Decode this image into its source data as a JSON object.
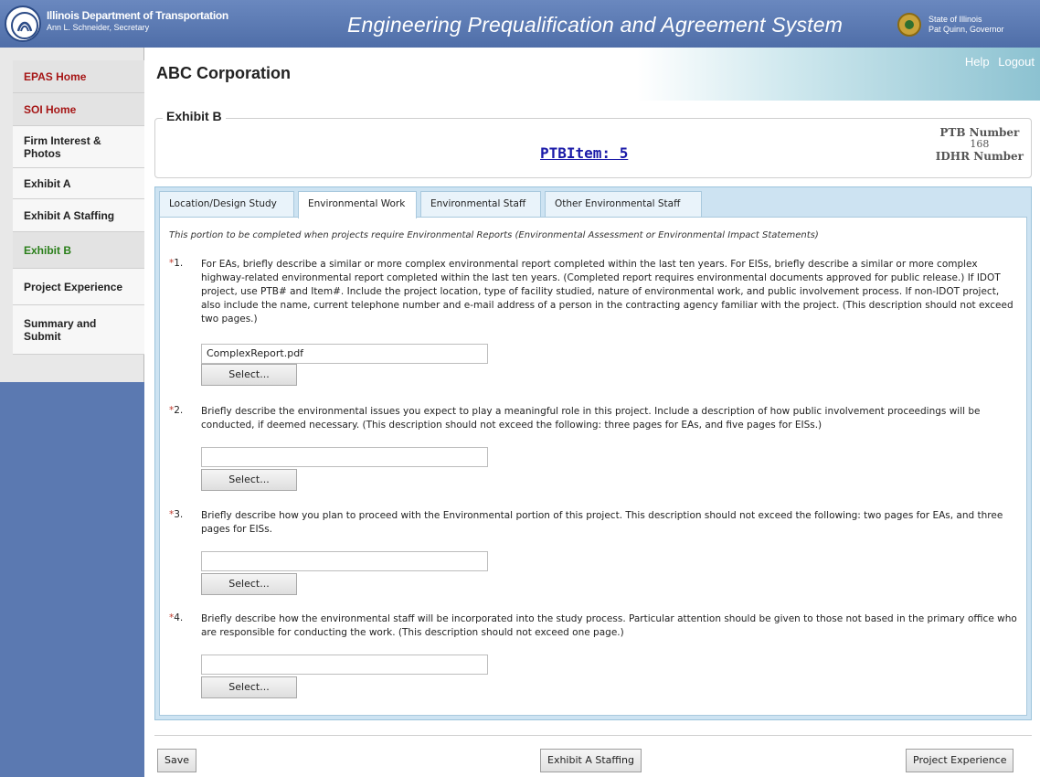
{
  "header": {
    "agency_line1": "Illinois Department of Transportation",
    "agency_line2": "Ann L. Schneider, Secretary",
    "app_title": "Engineering Prequalification and Agreement System",
    "state_line1": "State of Illinois",
    "state_line2": "Pat Quinn, Governor",
    "logo_icon": "idot-logo-icon",
    "seal_icon": "state-seal-icon"
  },
  "sidebar": {
    "items": [
      {
        "label": "EPAS Home",
        "style": "red"
      },
      {
        "label": "SOI Home",
        "style": "red"
      },
      {
        "label": "Firm Interest & Photos",
        "style": "normal"
      },
      {
        "label": "Exhibit A",
        "style": "normal"
      },
      {
        "label": "Exhibit A Staffing",
        "style": "normal"
      },
      {
        "label": "Exhibit B",
        "style": "green"
      },
      {
        "label": "Project Experience",
        "style": "normal"
      },
      {
        "label": "Summary and Submit",
        "style": "normal"
      }
    ]
  },
  "top_links": {
    "help": "Help",
    "logout": "Logout"
  },
  "company": "ABC Corporation",
  "exhibit": {
    "title": "Exhibit B",
    "ptb_item": "PTBItem: 5",
    "ptb_label": "PTB Number",
    "ptb_value": "168",
    "idhr_label": "IDHR Number"
  },
  "tabs": [
    {
      "label": "Location/Design Study",
      "active": false
    },
    {
      "label": "Environmental Work",
      "active": true
    },
    {
      "label": "Environmental Staff",
      "active": false
    },
    {
      "label": "Other Environmental Staff",
      "active": false
    }
  ],
  "intro": "This portion to be completed when projects require Environmental Reports (Environmental Assessment or Environmental Impact Statements)",
  "questions": [
    {
      "required_mark": "*",
      "number": "1.",
      "text": "For EAs, briefly describe a similar or more complex environmental report completed within the last ten years. For EISs, briefly describe a similar or more complex highway-related environmental report completed within the last ten years. (Completed report requires environmental documents approved for public release.) If IDOT project, use PTB# and Item#. Include the project location, type of facility studied, nature of environmental work, and public involvement process. If non-IDOT project, also include the name, current telephone number and e-mail address of a person in the contracting agency familiar with the project. (This description should not exceed two pages.)",
      "file_value": "ComplexReport.pdf",
      "button_label": "Select..."
    },
    {
      "required_mark": "*",
      "number": "2.",
      "text": "Briefly describe the environmental issues you expect to play a meaningful role in this project. Include a description of how public involvement proceedings will be conducted, if deemed necessary. (This description should not exceed the following: three pages for EAs, and five pages for EISs.)",
      "file_value": "",
      "button_label": "Select..."
    },
    {
      "required_mark": "*",
      "number": "3.",
      "text": "Briefly describe how you plan to proceed with the Environmental portion of this project. This description should not exceed the following: two pages for EAs, and three pages for EISs.",
      "file_value": "",
      "button_label": "Select..."
    },
    {
      "required_mark": "*",
      "number": "4.",
      "text": "Briefly describe how the environmental staff will be incorporated into the study process. Particular attention should be given to those not based in the primary office who are responsible for conducting the work. (This description should not exceed one page.)",
      "file_value": "",
      "button_label": "Select..."
    }
  ],
  "footer": {
    "save": "Save",
    "prev": "Exhibit A Staffing",
    "next": "Project Experience"
  }
}
